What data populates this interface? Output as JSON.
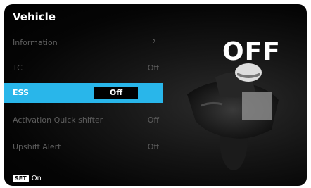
{
  "header": {
    "title": "Vehicle"
  },
  "menu": {
    "items": [
      {
        "label": "Information",
        "value": ""
      },
      {
        "label": "TC",
        "value": "Off"
      },
      {
        "label": "ESS",
        "value": "Off"
      },
      {
        "label": "Activation Quick shifter",
        "value": "Off"
      },
      {
        "label": "Upshift Alert",
        "value": "Off"
      }
    ]
  },
  "status": {
    "big": "OFF"
  },
  "footer": {
    "badge": "SET",
    "text": "On"
  },
  "colors": {
    "accent": "#29b6ea",
    "background": "#000000"
  },
  "icons": {
    "chevron": "chevron-right-icon",
    "illustration": "motorcycle-rider-illustration"
  }
}
